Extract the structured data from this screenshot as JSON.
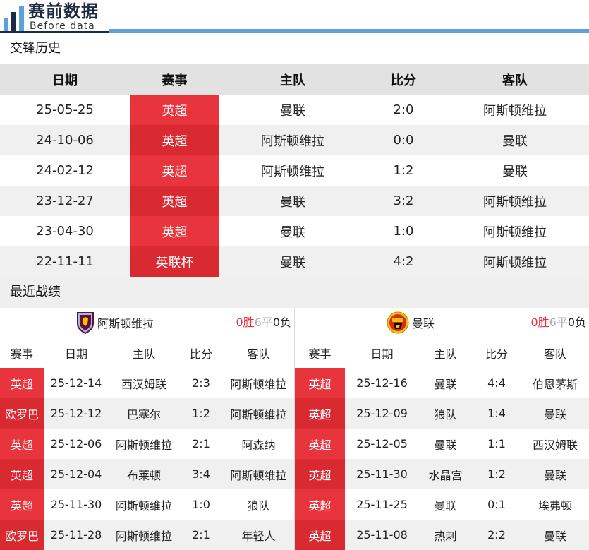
{
  "header": {
    "title": "赛前数据",
    "subtitle": "Before data",
    "colors": {
      "dark": "#1f2a44",
      "blue": "#5ea0dc"
    }
  },
  "h2h": {
    "title": "交锋历史",
    "columns": [
      "日期",
      "赛事",
      "主队",
      "比分",
      "客队"
    ],
    "rows": [
      {
        "date": "25-05-25",
        "comp": "英超",
        "home": "曼联",
        "score": "2:0",
        "away": "阿斯顿维拉"
      },
      {
        "date": "24-10-06",
        "comp": "英超",
        "home": "阿斯顿维拉",
        "score": "0:0",
        "away": "曼联"
      },
      {
        "date": "24-02-12",
        "comp": "英超",
        "home": "阿斯顿维拉",
        "score": "1:2",
        "away": "曼联"
      },
      {
        "date": "23-12-27",
        "comp": "英超",
        "home": "曼联",
        "score": "3:2",
        "away": "阿斯顿维拉"
      },
      {
        "date": "23-04-30",
        "comp": "英超",
        "home": "曼联",
        "score": "1:0",
        "away": "阿斯顿维拉"
      },
      {
        "date": "22-11-11",
        "comp": "英联杯",
        "home": "曼联",
        "score": "4:2",
        "away": "阿斯顿维拉"
      }
    ]
  },
  "recent": {
    "title": "最近战绩",
    "columns": [
      "赛事",
      "日期",
      "主队",
      "比分",
      "客队"
    ],
    "left": {
      "team": "阿斯顿维拉",
      "crest_icon": "aston-villa-crest-icon",
      "record": {
        "win": "0胜",
        "draw": "6平",
        "loss": "0负"
      },
      "rows": [
        {
          "comp": "英超",
          "date": "25-12-14",
          "home": "西汉姆联",
          "score": "2:3",
          "away": "阿斯顿维拉"
        },
        {
          "comp": "欧罗巴",
          "date": "25-12-12",
          "home": "巴塞尔",
          "score": "1:2",
          "away": "阿斯顿维拉"
        },
        {
          "comp": "英超",
          "date": "25-12-06",
          "home": "阿斯顿维拉",
          "score": "2:1",
          "away": "阿森纳"
        },
        {
          "comp": "英超",
          "date": "25-12-04",
          "home": "布莱顿",
          "score": "3:4",
          "away": "阿斯顿维拉"
        },
        {
          "comp": "英超",
          "date": "25-11-30",
          "home": "阿斯顿维拉",
          "score": "1:0",
          "away": "狼队"
        },
        {
          "comp": "欧罗巴",
          "date": "25-11-28",
          "home": "阿斯顿维拉",
          "score": "2:1",
          "away": "年轻人"
        }
      ]
    },
    "right": {
      "team": "曼联",
      "crest_icon": "manchester-united-crest-icon",
      "record": {
        "win": "0胜",
        "draw": "6平",
        "loss": "0负"
      },
      "rows": [
        {
          "comp": "英超",
          "date": "25-12-16",
          "home": "曼联",
          "score": "4:4",
          "away": "伯恩茅斯"
        },
        {
          "comp": "英超",
          "date": "25-12-09",
          "home": "狼队",
          "score": "1:4",
          "away": "曼联"
        },
        {
          "comp": "英超",
          "date": "25-12-05",
          "home": "曼联",
          "score": "1:1",
          "away": "西汉姆联"
        },
        {
          "comp": "英超",
          "date": "25-11-30",
          "home": "水晶宫",
          "score": "1:2",
          "away": "曼联"
        },
        {
          "comp": "英超",
          "date": "25-11-25",
          "home": "曼联",
          "score": "0:1",
          "away": "埃弗顿"
        },
        {
          "comp": "英超",
          "date": "25-11-08",
          "home": "热刺",
          "score": "2:2",
          "away": "曼联"
        }
      ]
    }
  },
  "colors": {
    "competition_red": "#e8343c",
    "alt_row": "#f0f0f0",
    "header_gray": "#e2e2e2"
  }
}
